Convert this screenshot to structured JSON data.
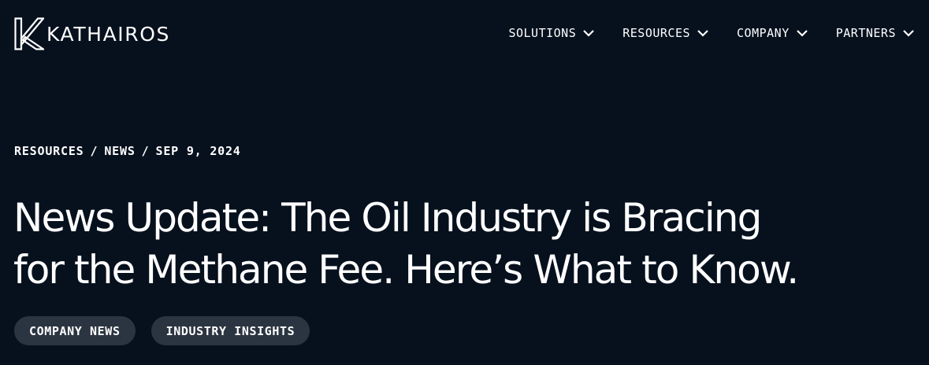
{
  "brand": {
    "name": "KATHAIROS",
    "logo_icon": "kathairos-k-mark-icon"
  },
  "nav": {
    "items": [
      {
        "label": "SOLUTIONS",
        "icon": "chevron-down-icon"
      },
      {
        "label": "RESOURCES",
        "icon": "chevron-down-icon"
      },
      {
        "label": "COMPANY",
        "icon": "chevron-down-icon"
      },
      {
        "label": "PARTNERS",
        "icon": "chevron-down-icon"
      }
    ]
  },
  "breadcrumb": {
    "items": [
      "RESOURCES",
      "NEWS",
      "SEP 9, 2024"
    ],
    "separator": "/"
  },
  "article": {
    "title_line1": "News Update: The Oil Industry is Bracing",
    "title_line2": "for the Methane Fee. Here’s What to Know."
  },
  "tags": [
    "COMPANY NEWS",
    "INDUSTRY INSIGHTS"
  ],
  "colors": {
    "background": "#07111e",
    "text": "#ffffff",
    "tag_background": "#2b3542"
  }
}
